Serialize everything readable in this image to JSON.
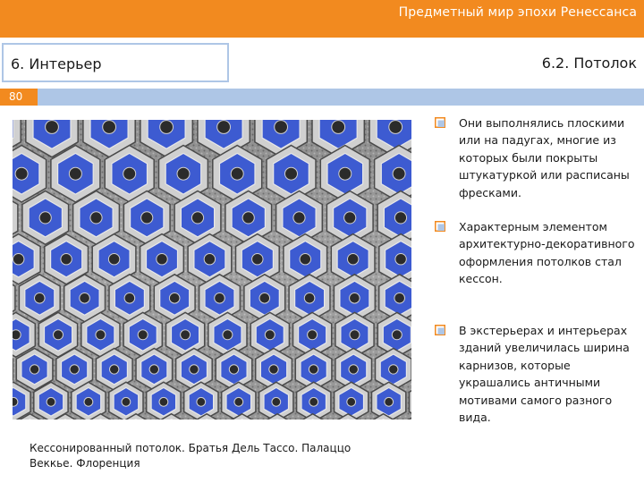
{
  "header": {
    "title": "Предметный мир эпохи Ренессанса",
    "section": "6. Интерьер",
    "subsection": "6.2. Потолок",
    "slide_number": "80"
  },
  "colors": {
    "accent_orange": "#f28a1f",
    "accent_blue": "#aec6e6",
    "coffer_blue": "#3d5bd1",
    "stucco_grey": "#b8b8b8"
  },
  "image": {
    "subject": "Кессонированный потолок с шестиугольными кессонами",
    "caption": "Кессонированный потолок. Братья Дель Тассо. Палаццо Веккье. Флоренция"
  },
  "bullets": [
    {
      "icon": "checkbox-bullet-icon",
      "text": "Они выполнялись плоскими или на падугах, многие из которых были покрыты штукатуркой или расписаны фресками."
    },
    {
      "icon": "checkbox-bullet-icon",
      "text": "Характерным элементом архитектурно-декоративного оформления потолков стал кессон."
    },
    {
      "icon": "checkbox-bullet-icon",
      "text": " В экстерьерах и интерьерах зданий увеличилась ширина карнизов, которые украшались античными мотивами самого разного вида."
    }
  ]
}
